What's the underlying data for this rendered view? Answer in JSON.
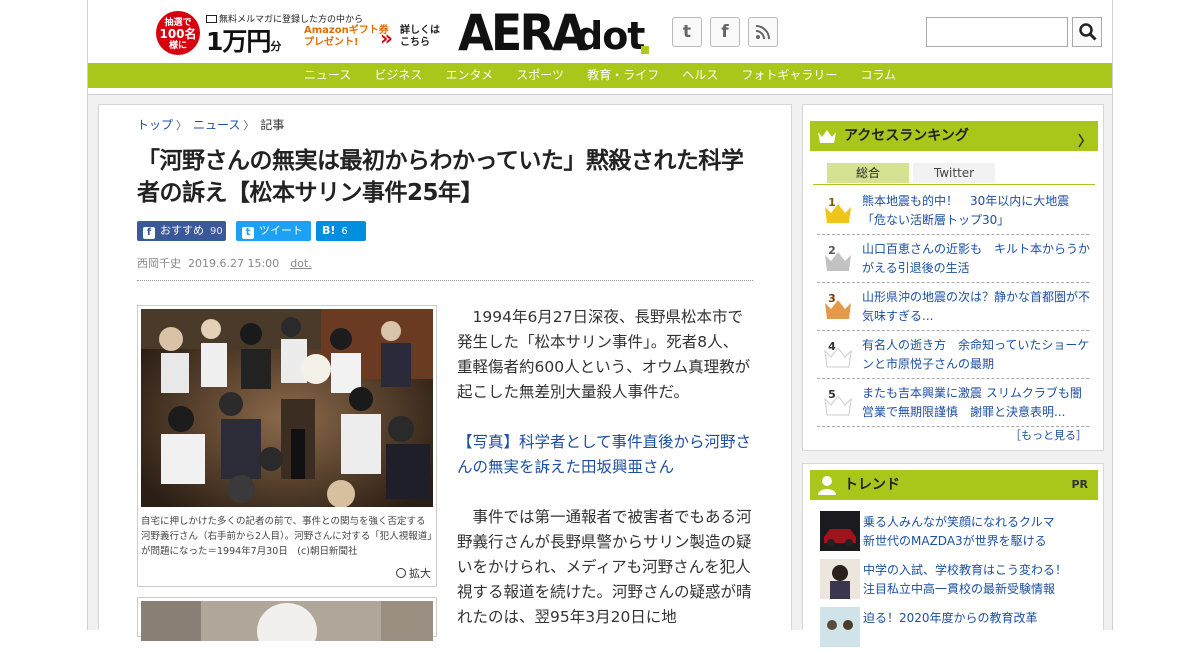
{
  "header": {
    "promo": {
      "circle_line1": "抽選で",
      "circle_line2": "100名",
      "circle_line3": "様に",
      "top_text": "無料メルマガに登録した方の中から",
      "amount": "1万円",
      "amount_unit": "分",
      "gift_line1": "Amazonギフト券",
      "gift_line2": "プレゼント!",
      "arrows": "»",
      "detail_line1": "詳しくは",
      "detail_line2": "こちら"
    },
    "logo_main": "AERA",
    "logo_sub": "dot",
    "social": [
      "twitter-icon",
      "facebook-icon",
      "rss-icon"
    ],
    "search": {
      "placeholder": "",
      "value": ""
    }
  },
  "nav": [
    "ニュース",
    "ビジネス",
    "エンタメ",
    "スポーツ",
    "教育・ライフ",
    "ヘルス",
    "フォトギャラリー",
    "コラム"
  ],
  "breadcrumb": {
    "home": "トップ",
    "news": "ニュース",
    "current": "記事"
  },
  "article": {
    "title": "「河野さんの無実は最初からわかっていた」黙殺された科学者の訴え【松本サリン事件25年】",
    "share": {
      "fb_label": "おすすめ",
      "fb_count": "90",
      "tw_label": "ツイート",
      "hb_label": "B!",
      "hb_count": "6"
    },
    "author": "西岡千史",
    "date": "2019.6.27 15:00",
    "source": "dot.",
    "caption": "自宅に押しかけた多くの記者の前で、事件との関与を強く否定する河野義行さん（右手前から2人目）。河野さんに対する「犯人視報道」が問題になった＝1994年7月30日　(c)朝日新聞社",
    "enlarge": "拡大",
    "para1": "1994年6月27日深夜、長野県松本市で発生した「松本サリン事件」。死者8人、重軽傷者約600人という、オウム真理教が起こした無差別大量殺人事件だ。",
    "photo_link": "【写真】科学者として事件直後から河野さんの無実を訴えた田坂興亜さん",
    "para2": "事件では第一通報者で被害者でもある河野義行さんが長野県警からサリン製造の疑いをかけられ、メディアも河野さんを犯人視する報道を続けた。河野さんの疑惑が晴れたのは、翌95年3月20日に地"
  },
  "ranking": {
    "title": "アクセスランキング",
    "tab_all": "総合",
    "tab_twitter": "Twitter",
    "items": [
      {
        "rank": "1",
        "text": "熊本地震も的中！　30年以内に大地震「危ない活断層トップ30」",
        "color": "#f0c419"
      },
      {
        "rank": "2",
        "text": "山口百恵さんの近影も　キルト本からうかがえる引退後の生活",
        "color": "#b9b9b9"
      },
      {
        "rank": "3",
        "text": "山形県沖の地震の次は？静かな首都圏が不気味すぎる...",
        "color": "#e59a4a"
      },
      {
        "rank": "4",
        "text": "有名人の逝き方　余命知っていたショーケンと市原悦子さんの最期",
        "color": "#ffffff"
      },
      {
        "rank": "5",
        "text": "またも吉本興業に激震 スリムクラブも闇営業で無期限謹慎　謝罪と決意表明...",
        "color": "#ffffff"
      }
    ],
    "more": "［もっと見る］"
  },
  "trend": {
    "title": "トレンド",
    "pr": "PR",
    "items": [
      {
        "line1": "乗る人みんなが笑顔になれるクルマ",
        "line2": "新世代のMAZDA3が世界を駆ける"
      },
      {
        "line1": "中学の入試、学校教育はこう変わる！",
        "line2": "注目私立中高一貫校の最新受験情報"
      },
      {
        "line1": "迫る！2020年度からの教育改革",
        "line2": ""
      }
    ]
  }
}
